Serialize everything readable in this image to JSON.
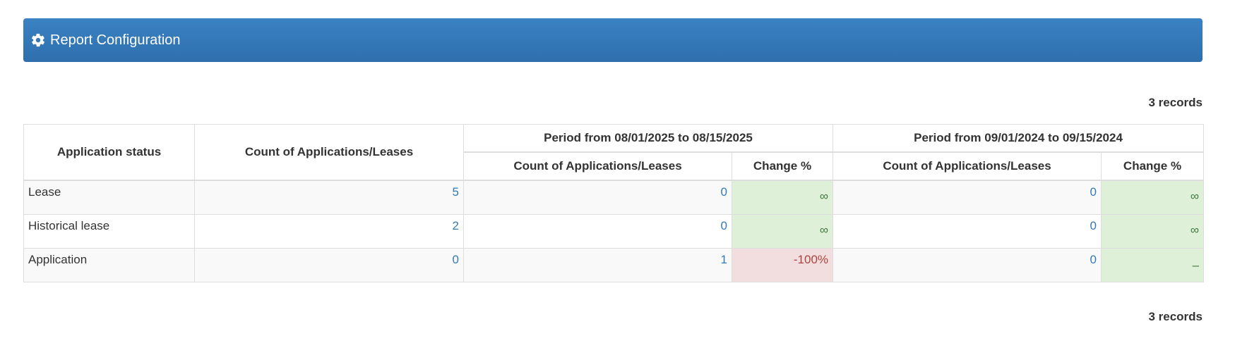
{
  "header": {
    "title": "Report Configuration",
    "icon": "gear-icon"
  },
  "records_top": "3 records",
  "records_bottom": "3 records",
  "table": {
    "col_status": "Application status",
    "col_count": "Count of Applications/Leases",
    "period1": {
      "label": "Period from 08/01/2025 to 08/15/2025",
      "col_count": "Count of Applications/Leases",
      "col_change": "Change %"
    },
    "period2": {
      "label": "Period from 09/01/2024 to 09/15/2024",
      "col_count": "Count of Applications/Leases",
      "col_change": "Change %"
    },
    "rows": [
      {
        "status": "Lease",
        "count": "5",
        "p1_count": "0",
        "p1_change": "∞",
        "p2_count": "0",
        "p2_change": "∞"
      },
      {
        "status": "Historical lease",
        "count": "2",
        "p1_count": "0",
        "p1_change": "∞",
        "p2_count": "0",
        "p2_change": "∞"
      },
      {
        "status": "Application",
        "count": "0",
        "p1_count": "1",
        "p1_change": "-100%",
        "p2_count": "0",
        "p2_change": "–"
      }
    ]
  },
  "colors": {
    "header_bar": "#337ab7",
    "link": "#337ab7",
    "positive_bg": "#dff0d8",
    "positive_text": "#3c763d",
    "negative_bg": "#f2dede",
    "negative_text": "#a94442"
  }
}
